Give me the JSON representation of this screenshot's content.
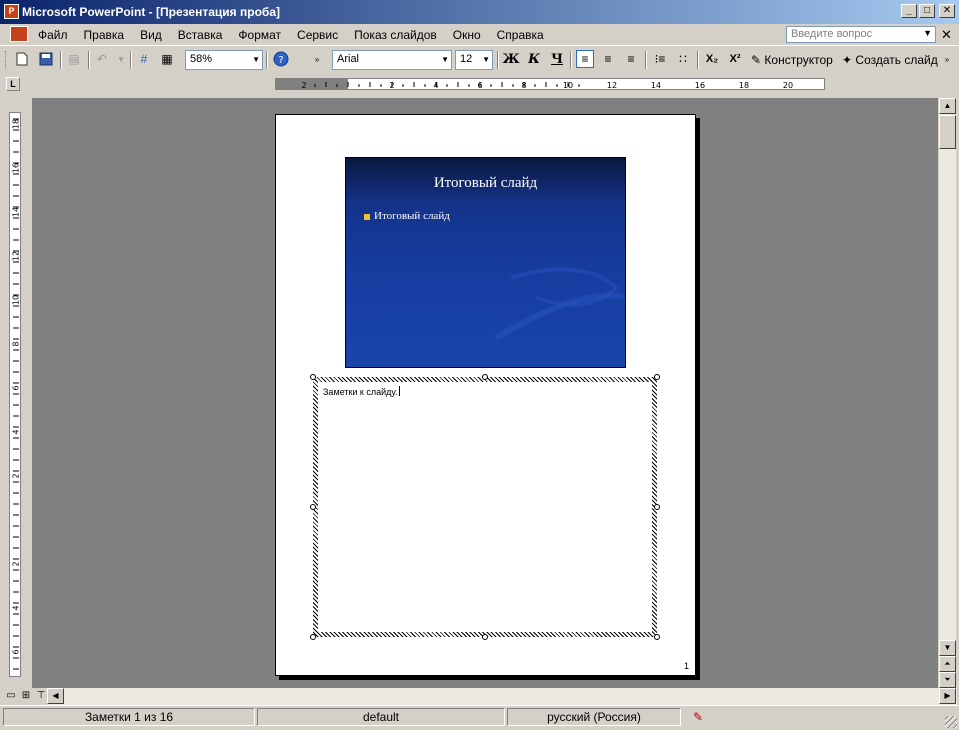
{
  "window": {
    "title": "Microsoft PowerPoint - [Презентация проба]"
  },
  "menu": {
    "items": [
      "Файл",
      "Правка",
      "Вид",
      "Вставка",
      "Формат",
      "Сервис",
      "Показ слайдов",
      "Окно",
      "Справка"
    ]
  },
  "help_box": {
    "placeholder": "Введите вопрос"
  },
  "toolbar": {
    "zoom": "58%",
    "font": "Arial",
    "font_size": "12",
    "bold_label": "Ж",
    "italic_label": "К",
    "underline_label": "Ч",
    "design_label": "Конструктор",
    "new_slide_label": "Создать слайд"
  },
  "ruler": {
    "h_labels": [
      "2",
      "2",
      "4",
      "6",
      "8",
      "10",
      "12",
      "14",
      "16",
      "18",
      "20"
    ],
    "v_labels": [
      "18",
      "16",
      "14",
      "12",
      "10",
      "8",
      "6",
      "4",
      "2",
      "2",
      "4",
      "6"
    ]
  },
  "slide": {
    "title": "Итоговый слайд",
    "bullet": "Итоговый слайд"
  },
  "notes": {
    "text": "Заметки к слайду."
  },
  "page": {
    "number": "1"
  },
  "status": {
    "slide_counter": "Заметки 1 из 16",
    "design": "default",
    "language": "русский (Россия)"
  },
  "colors": {
    "title_gradient_start": "#0a246a",
    "slide_bg": "#163da0",
    "bullet": "#f2c12e",
    "work_area": "#808080"
  }
}
